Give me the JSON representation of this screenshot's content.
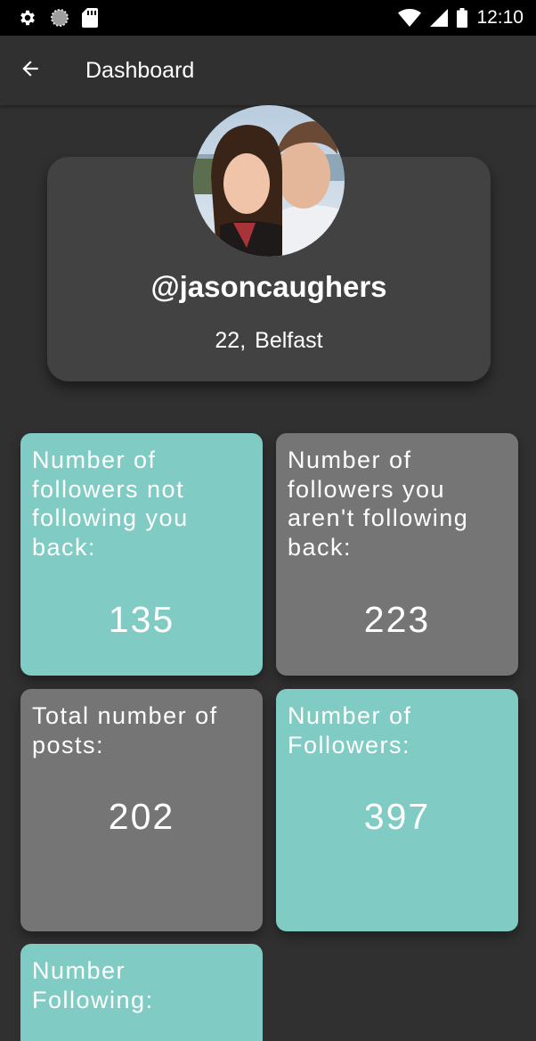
{
  "status_bar": {
    "time": "12:10",
    "left_icons": [
      "settings-icon",
      "sync-icon",
      "sd-card-icon"
    ],
    "right_icons": [
      "wifi-icon",
      "signal-icon",
      "battery-icon"
    ]
  },
  "app_bar": {
    "title": "Dashboard",
    "back_icon": "arrow-back-icon"
  },
  "profile": {
    "username": "@jasoncaughers",
    "age": "22,",
    "city": "Belfast"
  },
  "stats": [
    {
      "label": "Number of followers not following you back:",
      "value": "135",
      "color": "#80cbc4"
    },
    {
      "label": "Number of followers you aren't following back:",
      "value": "223",
      "color": "#757575"
    },
    {
      "label": "Total number of posts:",
      "value": "202",
      "color": "#757575"
    },
    {
      "label": "Number of Followers:",
      "value": "397",
      "color": "#80cbc4"
    },
    {
      "label": "Number Following:",
      "value": "",
      "color": "#80cbc4"
    }
  ],
  "colors": {
    "background": "#303030",
    "card": "#424242",
    "teal": "#80cbc4",
    "grey": "#757575"
  }
}
